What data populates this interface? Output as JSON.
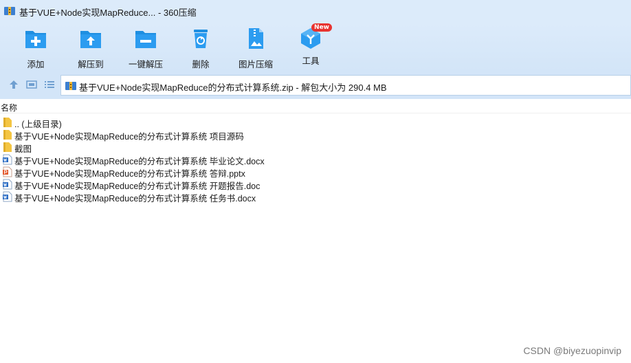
{
  "window": {
    "title": "基于VUE+Node实现MapReduce... - 360压缩",
    "app_icon": "archive-icon"
  },
  "toolbar": {
    "items": [
      {
        "label": "添加",
        "icon": "add-folder-icon"
      },
      {
        "label": "解压到",
        "icon": "extract-to-folder-icon"
      },
      {
        "label": "一键解压",
        "icon": "one-click-extract-icon"
      },
      {
        "label": "删除",
        "icon": "trash-icon"
      },
      {
        "label": "图片压缩",
        "icon": "image-compress-icon"
      },
      {
        "label": "工具",
        "icon": "tools-cube-icon",
        "badge": "New"
      }
    ]
  },
  "address": {
    "text": "基于VUE+Node实现MapReduce的分布式计算系统.zip - 解包大小为 290.4 MB"
  },
  "list": {
    "column_name": "名称",
    "rows": [
      {
        "name": ".. (上级目录)",
        "type": "folder"
      },
      {
        "name": "基于VUE+Node实现MapReduce的分布式计算系统 项目源码",
        "type": "folder"
      },
      {
        "name": "截图",
        "type": "folder"
      },
      {
        "name": "基于VUE+Node实现MapReduce的分布式计算系统 毕业论文.docx",
        "type": "word"
      },
      {
        "name": "基于VUE+Node实现MapReduce的分布式计算系统 答辩.pptx",
        "type": "ppt"
      },
      {
        "name": "基于VUE+Node实现MapReduce的分布式计算系统 开题报告.doc",
        "type": "word"
      },
      {
        "name": "基于VUE+Node实现MapReduce的分布式计算系统 任务书.docx",
        "type": "word"
      }
    ]
  },
  "watermark": "CSDN @biyezuopinvip",
  "colors": {
    "toolbar_bg": "#dcebfa",
    "icon_blue": "#1e8fe1",
    "folder_yellow": "#f4c542",
    "word_blue": "#2b6cc4",
    "ppt_orange": "#e2572c",
    "badge_red": "#e8332f"
  }
}
